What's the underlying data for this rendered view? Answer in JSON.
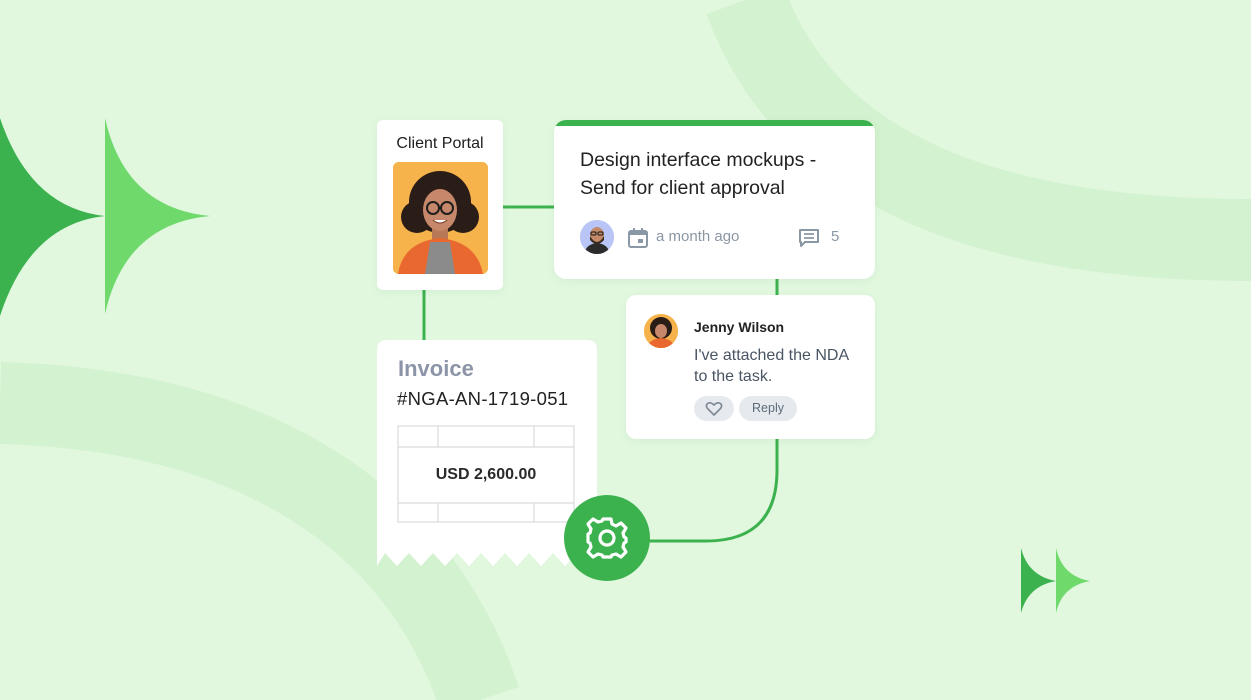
{
  "colors": {
    "background": "#e1f8df",
    "accent": "#3cb24f",
    "accent_light": "#6fd96c",
    "card": "#ffffff",
    "muted_text": "#8a97a4"
  },
  "client_portal": {
    "title": "Client Portal",
    "photo_icon": "person-photo"
  },
  "task": {
    "title": "Design interface mockups - Send for client approval",
    "date_icon": "calendar-icon",
    "date": "a month ago",
    "comments_icon": "chat-bubble-icon",
    "comment_count": "5"
  },
  "comment": {
    "author": "Jenny Wilson",
    "text": "I've attached the NDA to the task.",
    "like_icon": "heart-icon",
    "reply_label": "Reply"
  },
  "invoice": {
    "label": "Invoice",
    "number": "#NGA-AN-1719-051",
    "amount": "USD 2,600.00"
  },
  "automation": {
    "icon": "gear-icon"
  }
}
